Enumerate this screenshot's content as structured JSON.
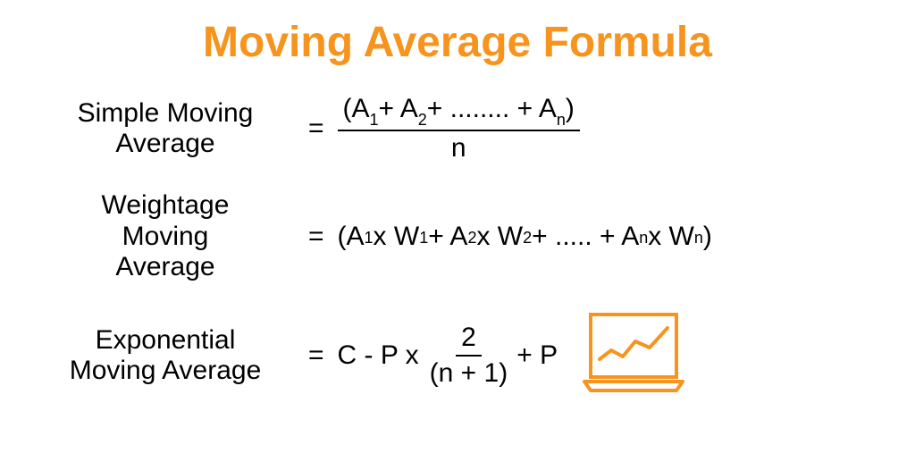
{
  "title": "Moving Average Formula",
  "formulas": {
    "sma": {
      "label_line1": "Simple Moving",
      "label_line2": "Average",
      "equals": "=",
      "numerator_plain": "(A1+ A2+ ........ + An)",
      "denominator": "n"
    },
    "wma": {
      "label_line1": "Weightage",
      "label_line2": "Moving",
      "label_line3": "Average",
      "equals": "=",
      "expr_plain": "(A1 x W1 + A2 x W2 + ..... + An x Wn)"
    },
    "ema": {
      "label_line1": "Exponential",
      "label_line2": "Moving Average",
      "equals": "=",
      "prefix": "C - P x",
      "frac_top": "2",
      "frac_bot": "(n + 1)",
      "suffix": "+ P"
    }
  },
  "colors": {
    "accent": "#f7941e",
    "text": "#000000"
  },
  "icon": "laptop-chart-icon"
}
